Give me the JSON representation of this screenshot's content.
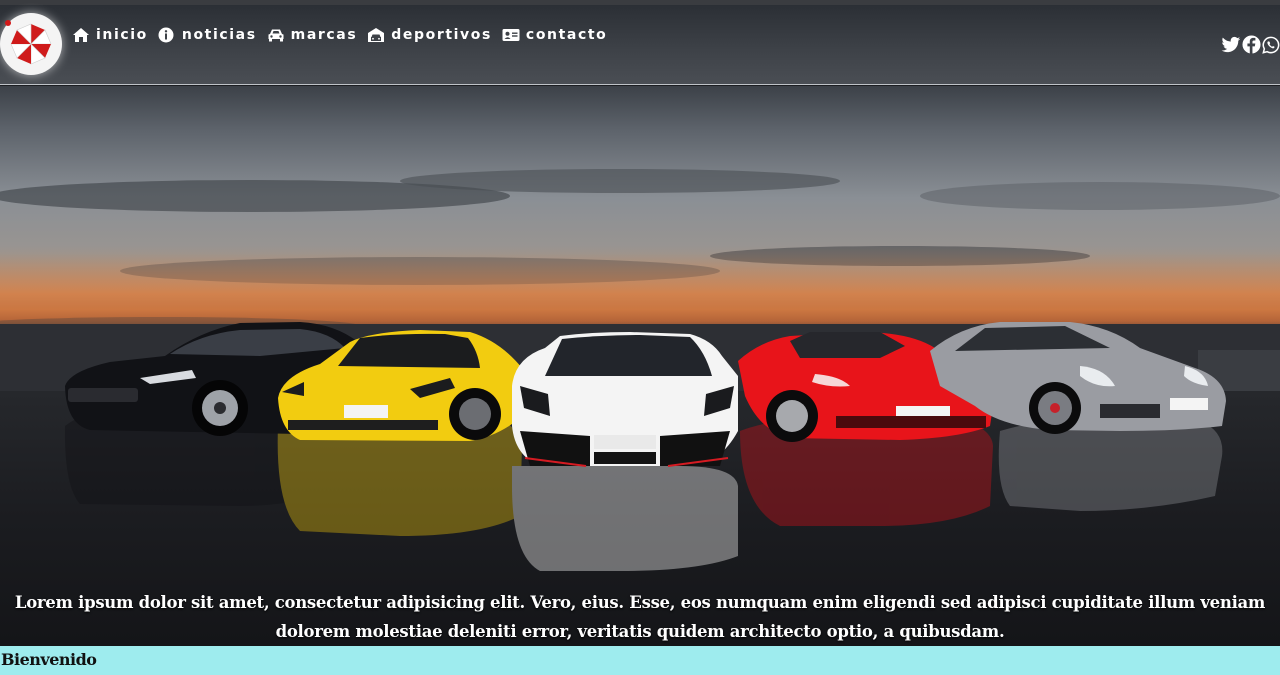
{
  "nav": {
    "items": [
      {
        "label": "inicio",
        "icon": "home-icon"
      },
      {
        "label": "noticias",
        "icon": "info-icon"
      },
      {
        "label": "marcas",
        "icon": "car-icon"
      },
      {
        "label": "deportivos",
        "icon": "garage-icon"
      },
      {
        "label": "contacto",
        "icon": "contact-card-icon"
      }
    ]
  },
  "social": {
    "icons": [
      "twitter-icon",
      "facebook-icon",
      "whatsapp-icon"
    ]
  },
  "hero": {
    "caption": "Lorem ipsum dolor sit amet, consectetur adipisicing elit. Vero, eius. Esse, eos numquam enim eligendi sed adipisci cupiditate illum veniam dolorem molestiae deleniti error, veritatis quidem architecto optio, a quibusdam.",
    "car_colors": [
      "#111216",
      "#f2cc10",
      "#f4f4f4",
      "#e8141a",
      "#9a9ca2"
    ]
  },
  "welcome": {
    "title": "Bienvenido"
  },
  "colors": {
    "navbar": "#3d4147",
    "welcome_bar": "#9eecee",
    "text_light": "#ffffff"
  }
}
